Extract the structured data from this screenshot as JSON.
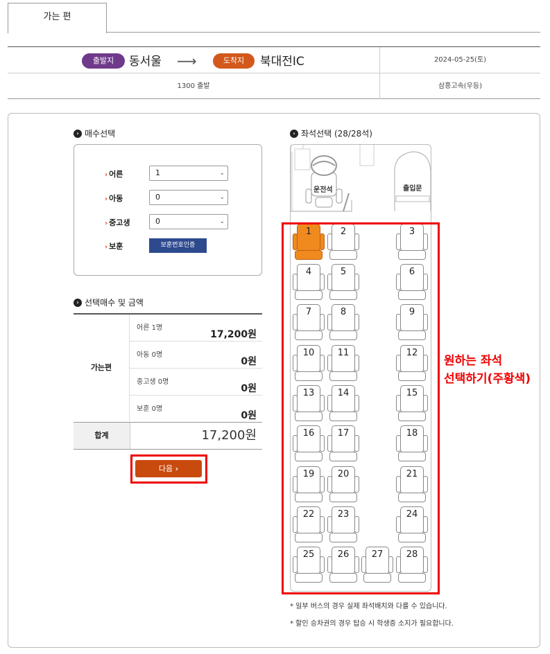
{
  "tab": {
    "label": "가는 편"
  },
  "trip": {
    "dep_badge": "출발지",
    "dep_city": "동서울",
    "arrow": "⟶",
    "arr_badge": "도착지",
    "arr_city": "북대전IC",
    "date": "2024-05-25(토)",
    "depart_time": "1300 출발",
    "company": "삼흥고속(우등)"
  },
  "count_section": {
    "title": "매수선택",
    "rows": [
      {
        "label": "어른",
        "value": "1"
      },
      {
        "label": "아동",
        "value": "0"
      },
      {
        "label": "중고생",
        "value": "0"
      },
      {
        "label": "보훈",
        "button": "보훈번호인증"
      }
    ]
  },
  "price_section": {
    "title": "선택매수 및 금액",
    "direction": "가는편",
    "rows": [
      {
        "label": "어른 1명",
        "amount": "17,200원"
      },
      {
        "label": "아동 0명",
        "amount": "0원"
      },
      {
        "label": "중고생 0명",
        "amount": "0원"
      },
      {
        "label": "보훈 0명",
        "amount": "0원"
      }
    ],
    "total_label": "합계",
    "total_amount": "17,200원"
  },
  "next_button": "다음",
  "seat_section": {
    "title": "좌석선택 (28/28석)",
    "driver": "운전석",
    "door": "출입문",
    "selected_seat": 1,
    "seats": [
      "1",
      "2",
      "3",
      "4",
      "5",
      "6",
      "7",
      "8",
      "9",
      "10",
      "11",
      "12",
      "13",
      "14",
      "15",
      "16",
      "17",
      "18",
      "19",
      "20",
      "21",
      "22",
      "23",
      "24",
      "25",
      "26",
      "27",
      "28"
    ]
  },
  "annotation": {
    "line1": "원하는 좌석",
    "line2": "선택하기(주황색)"
  },
  "notes": [
    "* 일부 버스의 경우 실제 좌석배치와 다를 수 있습니다.",
    "* 할인 승차권의 경우 탑승 시 학생증 소지가 필요합니다."
  ],
  "colors": {
    "selected_seat": "#f08a1e",
    "highlight": "#ee0000",
    "dep_badge": "#6f3a8a",
    "arr_badge": "#d2581b"
  }
}
